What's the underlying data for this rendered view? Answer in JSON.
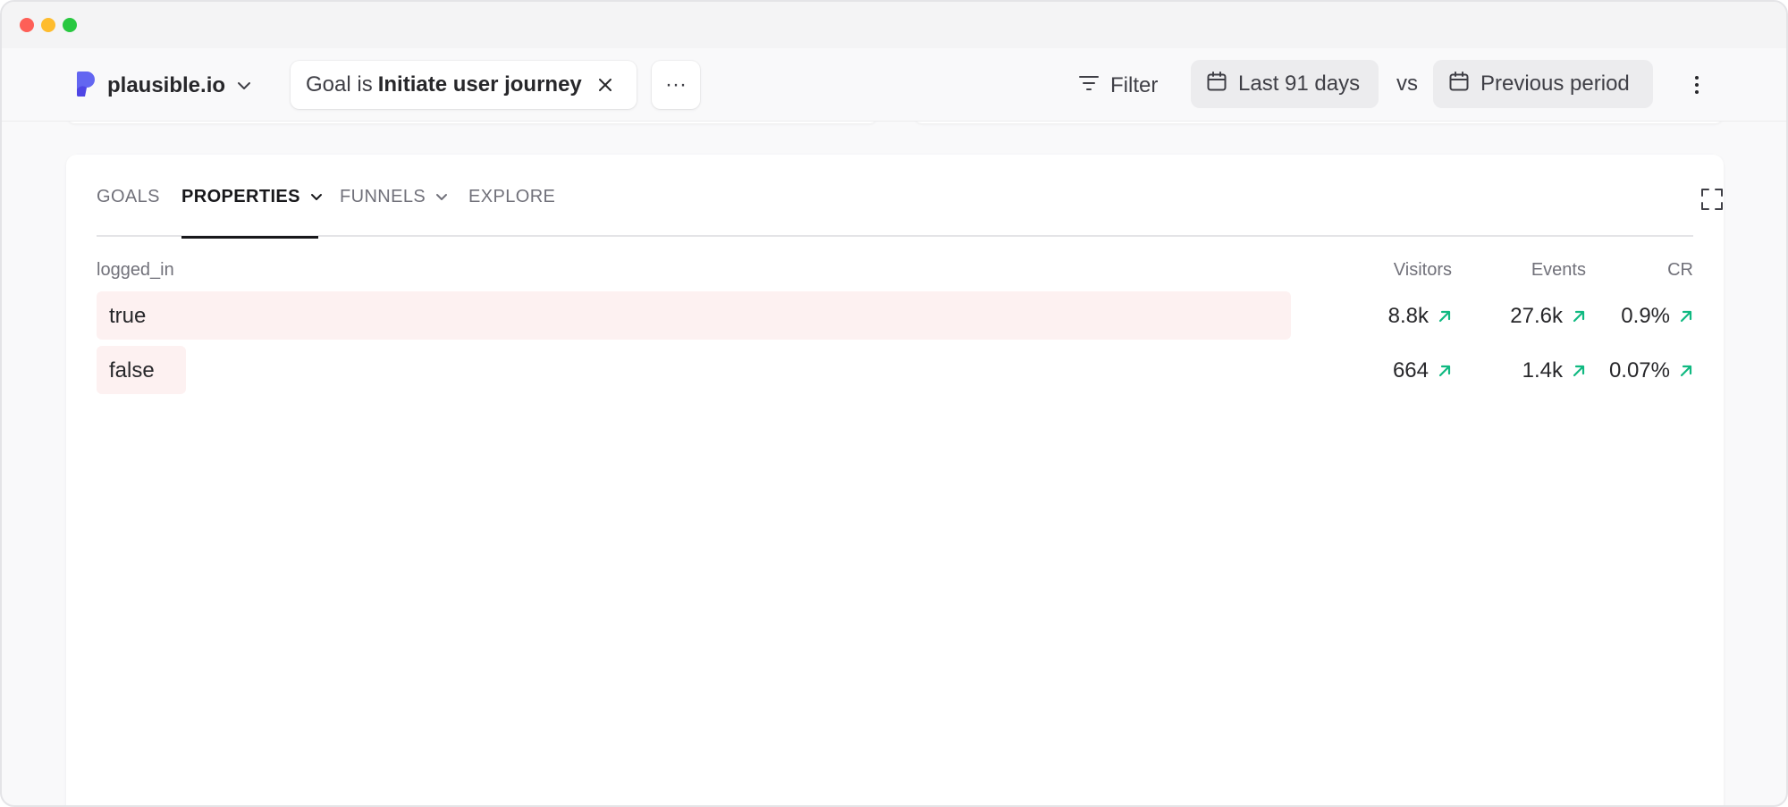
{
  "window": {
    "controls": [
      "close",
      "minimize",
      "maximize"
    ]
  },
  "header": {
    "site_name": "plausible.io",
    "goal_filter": {
      "prefix": "Goal is",
      "value": "Initiate user journey"
    },
    "more_label": "···",
    "filter_label": "Filter",
    "period_label": "Last 91 days",
    "vs_label": "vs",
    "compare_label": "Previous period"
  },
  "tabs": [
    {
      "label": "GOALS",
      "active": false
    },
    {
      "label": "PROPERTIES",
      "active": true
    },
    {
      "label": "FUNNELS",
      "active": false
    },
    {
      "label": "EXPLORE",
      "active": false
    }
  ],
  "table": {
    "dimension_header": "logged_in",
    "columns": [
      "Visitors",
      "Events",
      "CR"
    ],
    "rows": [
      {
        "label": "true",
        "visitors": "8.8k",
        "events": "27.6k",
        "cr": "0.9%",
        "bar_fraction": 0.748
      },
      {
        "label": "false",
        "visitors": "664",
        "events": "1.4k",
        "cr": "0.07%",
        "bar_fraction": 0.056
      }
    ]
  },
  "colors": {
    "accent_brand": "#6366f1",
    "bar_fill": "#fdf1f1",
    "trend_up": "#10b981",
    "active_tab": "#18181b"
  },
  "icons": {
    "logo": "plausible-logo-icon",
    "site_dropdown": "chevron-down-icon",
    "remove_filter": "close-icon",
    "filter": "filter-lines-icon",
    "calendar": "calendar-icon",
    "menu": "kebab-menu-icon",
    "expand": "expand-icon",
    "trend": "arrow-up-right-icon"
  }
}
